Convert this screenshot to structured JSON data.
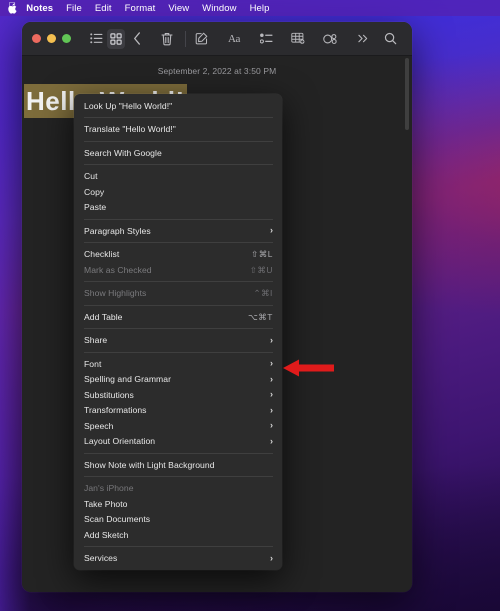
{
  "menubar": {
    "apple_icon": "apple-logo",
    "items": [
      {
        "label": "Notes",
        "bold": true
      },
      {
        "label": "File",
        "bold": false
      },
      {
        "label": "Edit",
        "bold": false
      },
      {
        "label": "Format",
        "bold": false
      },
      {
        "label": "View",
        "bold": false
      },
      {
        "label": "Window",
        "bold": false
      },
      {
        "label": "Help",
        "bold": false
      }
    ]
  },
  "window": {
    "app": "Notes",
    "traffic_lights": {
      "close_color": "#ed6a5f",
      "minimize_color": "#f4bf50",
      "zoom_color": "#61c555"
    },
    "toolbar": [
      {
        "name": "list-view-icon",
        "glyph": "list-view"
      },
      {
        "name": "gallery-view-icon",
        "glyph": "gallery-view",
        "selected": true
      },
      {
        "name": "back-chevron-icon",
        "glyph": "chevron-left"
      },
      {
        "name": "delete-note-icon",
        "glyph": "trash"
      },
      {
        "name": "compose-note-icon",
        "glyph": "compose"
      },
      {
        "name": "format-text-icon",
        "glyph": "Aa"
      },
      {
        "name": "checklist-icon",
        "glyph": "checklist"
      },
      {
        "name": "add-table-icon",
        "glyph": "table"
      },
      {
        "name": "share-collaborate-icon",
        "glyph": "collaborate"
      },
      {
        "name": "more-toolbar-icon",
        "glyph": "chevron-double-right"
      },
      {
        "name": "search-icon",
        "glyph": "magnifier"
      }
    ]
  },
  "note": {
    "date": "September 2, 2022 at 3:50 PM",
    "title": "Hello World!",
    "selection_color": "#7d6c3b"
  },
  "context_menu": {
    "groups": [
      {
        "items": [
          {
            "label": "Look Up \"Hello World!\"",
            "shortcut": "",
            "submenu": false,
            "disabled": false
          }
        ]
      },
      {
        "items": [
          {
            "label": "Translate \"Hello World!\"",
            "shortcut": "",
            "submenu": false,
            "disabled": false
          }
        ]
      },
      {
        "items": [
          {
            "label": "Search With Google",
            "shortcut": "",
            "submenu": false,
            "disabled": false
          }
        ]
      },
      {
        "items": [
          {
            "label": "Cut",
            "shortcut": "",
            "submenu": false,
            "disabled": false
          },
          {
            "label": "Copy",
            "shortcut": "",
            "submenu": false,
            "disabled": false
          },
          {
            "label": "Paste",
            "shortcut": "",
            "submenu": false,
            "disabled": false
          }
        ]
      },
      {
        "items": [
          {
            "label": "Paragraph Styles",
            "shortcut": "",
            "submenu": true,
            "disabled": false
          }
        ]
      },
      {
        "items": [
          {
            "label": "Checklist",
            "shortcut": "⇧⌘L",
            "submenu": false,
            "disabled": false
          },
          {
            "label": "Mark as Checked",
            "shortcut": "⇧⌘U",
            "submenu": false,
            "disabled": true
          }
        ]
      },
      {
        "items": [
          {
            "label": "Show Highlights",
            "shortcut": "⌃⌘I",
            "submenu": false,
            "disabled": true
          }
        ]
      },
      {
        "items": [
          {
            "label": "Add Table",
            "shortcut": "⌥⌘T",
            "submenu": false,
            "disabled": false
          }
        ]
      },
      {
        "items": [
          {
            "label": "Share",
            "shortcut": "",
            "submenu": true,
            "disabled": false
          }
        ]
      },
      {
        "items": [
          {
            "label": "Font",
            "shortcut": "",
            "submenu": true,
            "disabled": false
          },
          {
            "label": "Spelling and Grammar",
            "shortcut": "",
            "submenu": true,
            "disabled": false
          },
          {
            "label": "Substitutions",
            "shortcut": "",
            "submenu": true,
            "disabled": false
          },
          {
            "label": "Transformations",
            "shortcut": "",
            "submenu": true,
            "disabled": false
          },
          {
            "label": "Speech",
            "shortcut": "",
            "submenu": true,
            "disabled": false
          },
          {
            "label": "Layout Orientation",
            "shortcut": "",
            "submenu": true,
            "disabled": false
          }
        ]
      },
      {
        "items": [
          {
            "label": "Show Note with Light Background",
            "shortcut": "",
            "submenu": false,
            "disabled": false
          }
        ]
      },
      {
        "items": [
          {
            "label": "Jan's iPhone",
            "shortcut": "",
            "submenu": false,
            "disabled": false,
            "section_header": true
          },
          {
            "label": "Take Photo",
            "shortcut": "",
            "submenu": false,
            "disabled": false
          },
          {
            "label": "Scan Documents",
            "shortcut": "",
            "submenu": false,
            "disabled": false
          },
          {
            "label": "Add Sketch",
            "shortcut": "",
            "submenu": false,
            "disabled": false
          }
        ]
      },
      {
        "items": [
          {
            "label": "Services",
            "shortcut": "",
            "submenu": true,
            "disabled": false
          }
        ]
      }
    ]
  },
  "annotation": {
    "arrow_color": "#e01b1b",
    "points_to": "Font",
    "direction": "left"
  }
}
